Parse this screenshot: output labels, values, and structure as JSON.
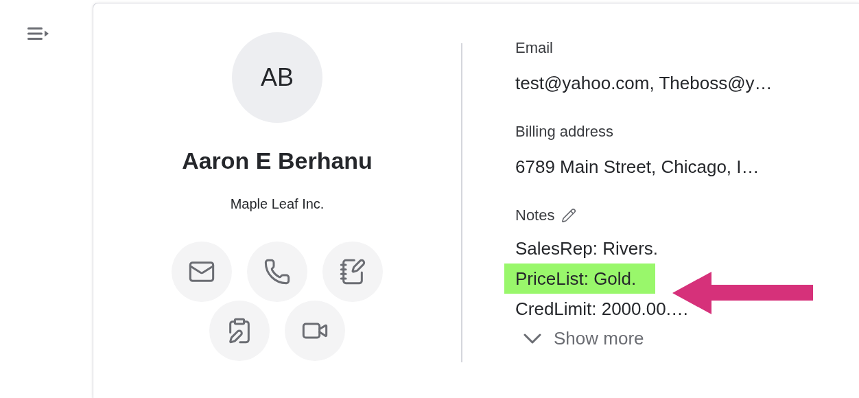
{
  "contact": {
    "initials": "AB",
    "name": "Aaron E Berhanu",
    "company": "Maple Leaf Inc."
  },
  "actions": [
    {
      "kind": "email"
    },
    {
      "kind": "phone"
    },
    {
      "kind": "note"
    },
    {
      "kind": "task"
    },
    {
      "kind": "video"
    }
  ],
  "fields": [
    {
      "label": "Email",
      "value": "test@yahoo.com, Theboss@y…"
    },
    {
      "label": "Billing address",
      "value": "6789 Main Street, Chicago, I…"
    }
  ],
  "notes": {
    "label": "Notes",
    "lines": [
      {
        "text": "SalesRep: Rivers.",
        "highlighted": false
      },
      {
        "text": "PriceList: Gold.",
        "highlighted": true
      },
      {
        "text": "CredLimit: 2000.00.…",
        "highlighted": false
      }
    ],
    "show_more": "Show more"
  }
}
